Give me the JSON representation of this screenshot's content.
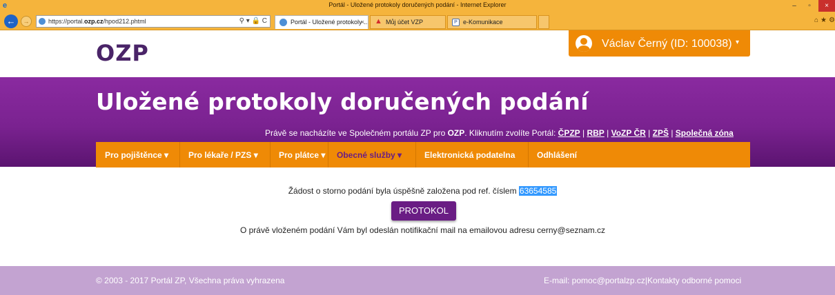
{
  "browser": {
    "window_title": "Portál - Uložené protokoly doručených podání - Internet Explorer",
    "url_prefix": "https://portal.",
    "url_domain": "ozp.cz",
    "url_path": "/hpod212.phtml",
    "address_tools": "⚲ ▾ 🔒 C",
    "tabs": [
      {
        "label": "Portál - Uložené protokoly ...",
        "close": "×"
      },
      {
        "label": "Můj účet VZP"
      },
      {
        "label": "e-Komunikace"
      }
    ],
    "window_controls": {
      "minimize": "–",
      "maximize": "▫",
      "close": "×"
    },
    "right_icons": "⌂★⚙"
  },
  "header": {
    "logo": "OZP",
    "user_label": "Václav Černý (ID: 100038)",
    "user_caret": "▾"
  },
  "band": {
    "title": "Uložené protokoly doručených podání",
    "portal_prefix": "Právě se nacházíte ve Společném portálu ZP pro ",
    "portal_bold": "OZP",
    "portal_mid": ". Kliknutím zvolíte Portál: ",
    "portal_links": [
      "ČPZP",
      "RBP",
      "VoZP ČR",
      "ZPŠ",
      "Společná zóna"
    ],
    "portal_sep": " | "
  },
  "menu": [
    {
      "label": "Pro pojištěnce",
      "caret": "▾"
    },
    {
      "label": "Pro lékaře / PZS",
      "caret": "▾"
    },
    {
      "label": "Pro plátce",
      "caret": "▾"
    },
    {
      "label": "Obecné služby",
      "caret": "▾"
    },
    {
      "label": "Elektronická podatelna",
      "caret": ""
    },
    {
      "label": "Odhlášení",
      "caret": ""
    }
  ],
  "content": {
    "message_prefix": "Žádost o storno podání byla úspěšně založena pod ref. číslem ",
    "ref_number": "63654585",
    "button_label": "PROTOKOL",
    "notification": "O právě vloženém podání Vám byl odeslán notifikační mail na emailovou adresu cerny@seznam.cz"
  },
  "footer": {
    "copyright": "© 2003 - 2017 Portál ZP, Všechna práva vyhrazena",
    "email_label": "E-mail: pomoc@portalzp.cz",
    "separator": "|",
    "contacts_label": "Kontakty odborné pomoci"
  },
  "colors": {
    "accent_orange": "#ef8a06",
    "brand_purple": "#7a2290",
    "footer_lilac": "#c3a3d1",
    "ie_chrome": "#f5b43c"
  }
}
